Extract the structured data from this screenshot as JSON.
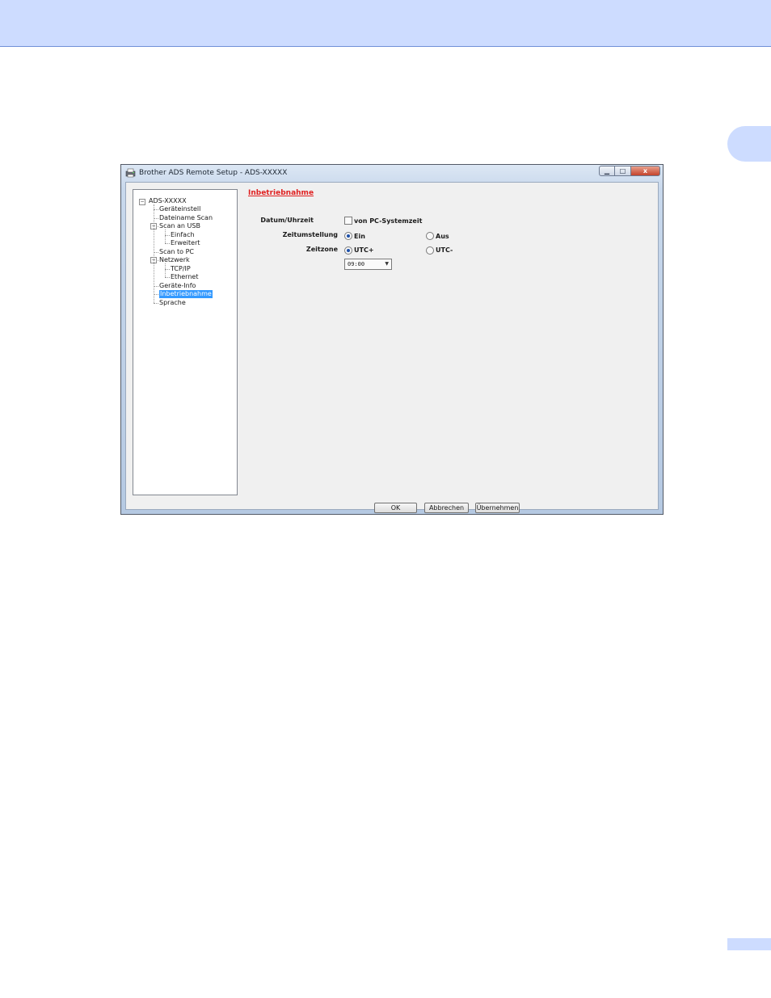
{
  "window": {
    "title": "Brother ADS Remote Setup - ADS-XXXXX",
    "controls": {
      "minimize": "▁",
      "maximize": "□",
      "close": "x"
    }
  },
  "tree": {
    "root": "ADS-XXXXX",
    "items": [
      {
        "label": "Geräteinstell",
        "level": 1
      },
      {
        "label": "Dateiname Scan",
        "level": 1
      },
      {
        "label": "Scan an USB",
        "level": 1,
        "expander": "−"
      },
      {
        "label": "Einfach",
        "level": 2
      },
      {
        "label": "Erweitert",
        "level": 2
      },
      {
        "label": "Scan to PC",
        "level": 1
      },
      {
        "label": "Netzwerk",
        "level": 1,
        "expander": "−"
      },
      {
        "label": "TCP/IP",
        "level": 2
      },
      {
        "label": "Ethernet",
        "level": 2
      },
      {
        "label": "Geräte-Info",
        "level": 1
      },
      {
        "label": "Inbetriebnahme",
        "level": 1,
        "selected": true
      },
      {
        "label": "Sprache",
        "level": 1
      }
    ],
    "root_expander": "−"
  },
  "panel": {
    "title": "Inbetriebnahme",
    "date_time_label": "Datum/Uhrzeit",
    "pc_time_checkbox": {
      "label": "von PC-Systemzeit",
      "checked": false
    },
    "dst_label": "Zeitumstellung",
    "dst_on": {
      "label": "Ein",
      "selected": true
    },
    "dst_off": {
      "label": "Aus",
      "selected": false
    },
    "timezone_label": "Zeitzone",
    "tz_plus": {
      "label": "UTC+",
      "selected": true
    },
    "tz_minus": {
      "label": "UTC-",
      "selected": false
    },
    "tz_offset": "09:00",
    "dropdown_arrow": "▼"
  },
  "buttons": {
    "ok": "OK",
    "cancel": "Abbrechen",
    "apply": "Übernehmen"
  },
  "colors": {
    "page_band": "#cddcff",
    "section_title": "#e02020",
    "selection": "#3399ff"
  }
}
